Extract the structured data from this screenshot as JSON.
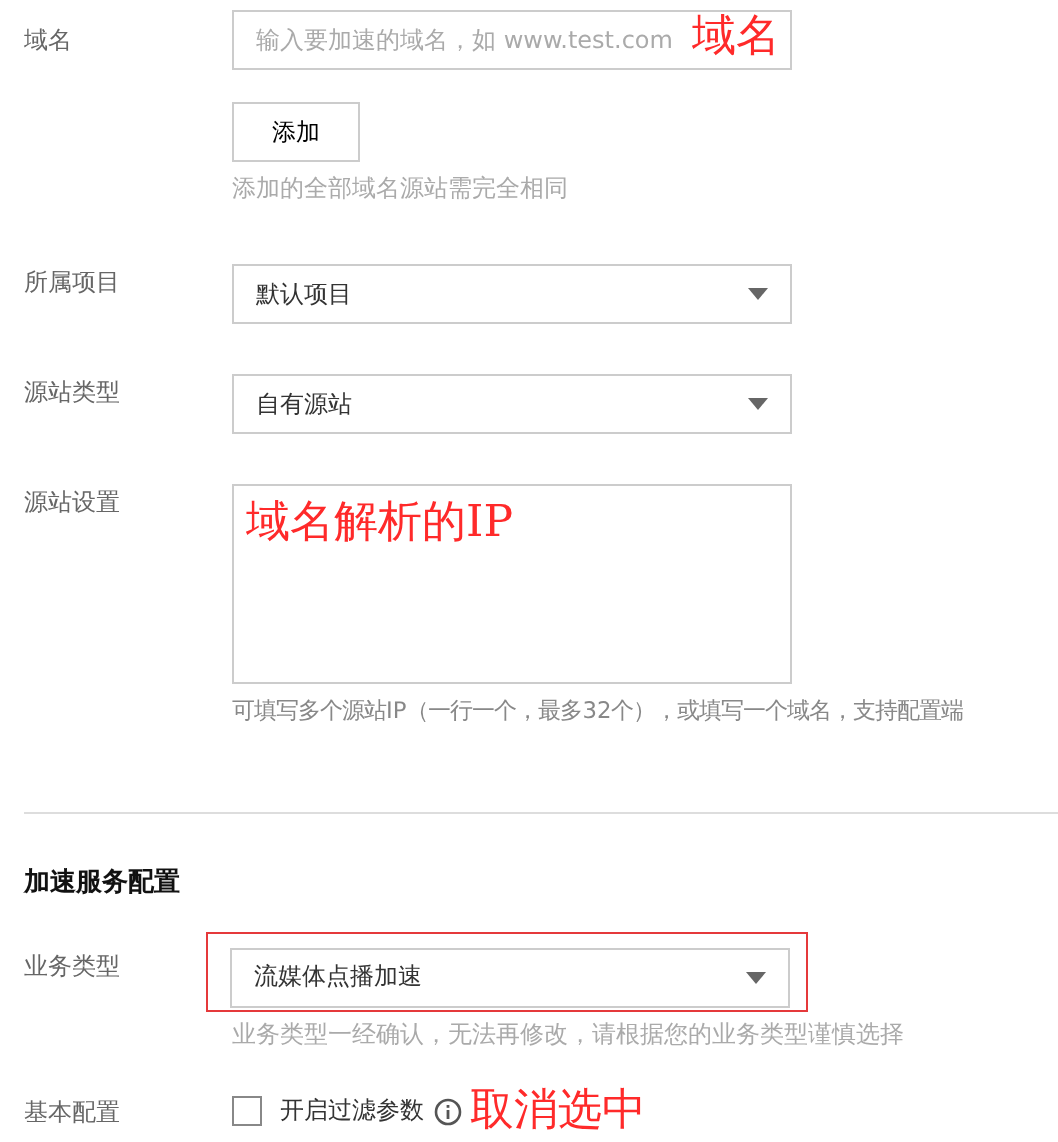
{
  "domain": {
    "label": "域名",
    "placeholder": "输入要加速的域名，如 www.test.com",
    "annotation": "域名",
    "add_button": "添加",
    "hint": "添加的全部域名源站需完全相同"
  },
  "project": {
    "label": "所属项目",
    "value": "默认项目"
  },
  "origin_type": {
    "label": "源站类型",
    "value": "自有源站"
  },
  "origin_settings": {
    "label": "源站设置",
    "annotation": "域名解析的IP",
    "hint": "可填写多个源站IP（一行一个，最多32个），或填写一个域名，支持配置端"
  },
  "section": {
    "title": "加速服务配置"
  },
  "business_type": {
    "label": "业务类型",
    "value": "流媒体点播加速",
    "highlighted": true,
    "hint": "业务类型一经确认，无法再修改，请根据您的业务类型谨慎选择"
  },
  "basic": {
    "label": "基本配置",
    "checkbox_label": "开启过滤参数",
    "checked": false,
    "annotation": "取消选中"
  }
}
